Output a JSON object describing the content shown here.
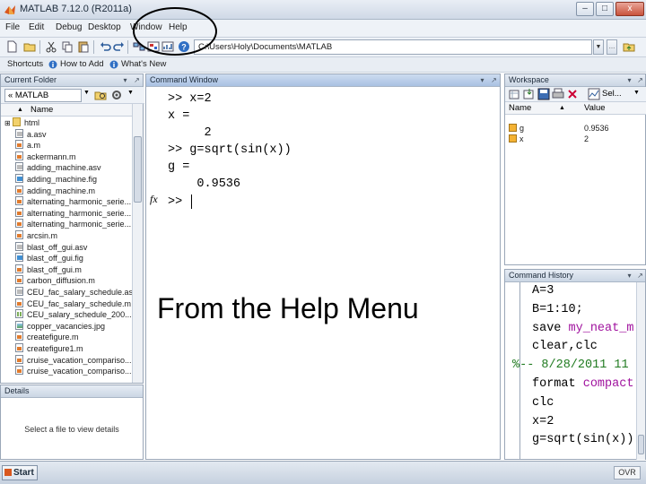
{
  "window": {
    "title": "MATLAB 7.12.0 (R2011a)",
    "minimize": "–",
    "maximize": "□",
    "close": "x"
  },
  "menu": [
    "File",
    "Edit",
    "Debug",
    "Desktop",
    "Window",
    "Help"
  ],
  "toolbar": {
    "current_folder": "C:\\Users\\Holy\\Documents\\MATLAB"
  },
  "shortcuts": [
    "Shortcuts",
    "How to Add",
    "What's New"
  ],
  "current_folder_panel": {
    "title": "Current Folder",
    "crumb": "« MATLAB",
    "column_name": "Name",
    "files": [
      {
        "name": "html",
        "type": "folder"
      },
      {
        "name": "a.asv",
        "type": "asv"
      },
      {
        "name": "a.m",
        "type": "mfile"
      },
      {
        "name": "ackermann.m",
        "type": "mfile"
      },
      {
        "name": "adding_machine.asv",
        "type": "asv"
      },
      {
        "name": "adding_machine.fig",
        "type": "fig"
      },
      {
        "name": "adding_machine.m",
        "type": "mfile"
      },
      {
        "name": "alternating_harmonic_serie...",
        "type": "mfile"
      },
      {
        "name": "alternating_harmonic_serie...",
        "type": "mfile"
      },
      {
        "name": "alternating_harmonic_serie...",
        "type": "mfile"
      },
      {
        "name": "arcsin.m",
        "type": "mfile"
      },
      {
        "name": "blast_off_gui.asv",
        "type": "asv"
      },
      {
        "name": "blast_off_gui.fig",
        "type": "fig"
      },
      {
        "name": "blast_off_gui.m",
        "type": "mfile"
      },
      {
        "name": "carbon_diffusion.m",
        "type": "mfile"
      },
      {
        "name": "CEU_fac_salary_schedule.asv",
        "type": "asv"
      },
      {
        "name": "CEU_fac_salary_schedule.m",
        "type": "mfile"
      },
      {
        "name": "CEU_salary_schedule_200...",
        "type": "csv"
      },
      {
        "name": "copper_vacancies.jpg",
        "type": "img"
      },
      {
        "name": "createfigure.m",
        "type": "mfile"
      },
      {
        "name": "createfigure1.m",
        "type": "mfile"
      },
      {
        "name": "cruise_vacation_compariso...",
        "type": "mfile"
      },
      {
        "name": "cruise_vacation_compariso...",
        "type": "mfile"
      }
    ],
    "details_title": "Details",
    "details_hint": "Select a file to view details"
  },
  "command_window": {
    "title": "Command Window",
    "lines": [
      ">> x=2",
      "x =",
      "     2",
      ">> g=sqrt(sin(x))",
      "g =",
      "    0.9536"
    ],
    "prompt": ">>",
    "fx_label": "fx"
  },
  "overlay_caption": "From the Help Menu",
  "workspace": {
    "title": "Workspace",
    "select_label": "Sel...",
    "columns": [
      "Name",
      "Value"
    ],
    "vars": [
      {
        "name": "g",
        "value": "0.9536"
      },
      {
        "name": "x",
        "value": "2"
      }
    ]
  },
  "command_history": {
    "title": "Command History",
    "lines": [
      {
        "text": "A=3",
        "kind": "plain"
      },
      {
        "text": "B=1:10;",
        "kind": "plain"
      },
      {
        "text": "save ",
        "kw": "my_neat_m",
        "kind": "mixed"
      },
      {
        "text": "clear,clc",
        "kind": "plain"
      },
      {
        "text": "%-- 8/28/2011 11",
        "kind": "session"
      },
      {
        "text": "format ",
        "kw": "compact",
        "kind": "mixed"
      },
      {
        "text": "clc",
        "kind": "plain"
      },
      {
        "text": "x=2",
        "kind": "plain"
      },
      {
        "text": "g=sqrt(sin(x))",
        "kind": "plain"
      }
    ]
  },
  "statusbar": {
    "start_label": "Start",
    "ovr": "OVR"
  }
}
